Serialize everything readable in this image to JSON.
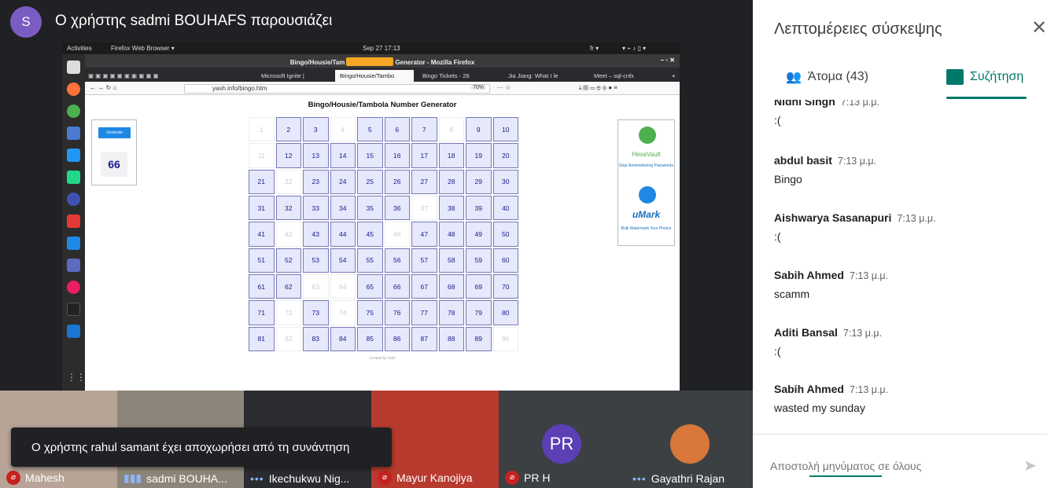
{
  "presenter": {
    "initial": "S",
    "title": "Ο χρήστης sadmi BOUHAFS παρουσιάζει"
  },
  "gnome": {
    "activities": "Activities",
    "app": "Firefox Web Browser ▾",
    "clock": "Sep 27  17:13",
    "lang": "fr ▾"
  },
  "firefox": {
    "window_title": "Bingo/Housie/Tam",
    "window_title_tail": "Generator - Mozilla Firefox",
    "tabs": [
      {
        "label": "Microsoft Ignite |"
      },
      {
        "label": "Bingo/Housie/Tambo"
      },
      {
        "label": "Bingo Tickets - 26"
      },
      {
        "label": "Jia Jiang: What I le"
      },
      {
        "label": "Meet – sql-cnfx"
      }
    ],
    "url": "yash.info/bingo.htm",
    "zoom": "70%"
  },
  "bingo": {
    "title": "Bingo/Housie/Tambola Number Generator",
    "generate_label": "Generate",
    "current": "66",
    "created_by": "Created by Yash",
    "numbers": [
      "1",
      "2",
      "3",
      "4",
      "5",
      "6",
      "7",
      "8",
      "9",
      "10",
      "11",
      "12",
      "13",
      "14",
      "15",
      "16",
      "17",
      "18",
      "19",
      "20",
      "21",
      "22",
      "23",
      "24",
      "25",
      "26",
      "27",
      "28",
      "29",
      "30",
      "31",
      "32",
      "33",
      "34",
      "35",
      "36",
      "37",
      "38",
      "39",
      "40",
      "41",
      "42",
      "43",
      "44",
      "45",
      "46",
      "47",
      "48",
      "49",
      "50",
      "51",
      "52",
      "53",
      "54",
      "55",
      "56",
      "57",
      "58",
      "59",
      "60",
      "61",
      "62",
      "63",
      "64",
      "65",
      "66",
      "67",
      "68",
      "69",
      "70",
      "71",
      "72",
      "73",
      "74",
      "75",
      "76",
      "77",
      "78",
      "79",
      "80",
      "81",
      "82",
      "83",
      "84",
      "85",
      "86",
      "87",
      "88",
      "89",
      "90"
    ],
    "called": [
      "2",
      "3",
      "5",
      "6",
      "7",
      "9",
      "10",
      "12",
      "13",
      "14",
      "15",
      "16",
      "17",
      "18",
      "19",
      "20",
      "21",
      "23",
      "24",
      "25",
      "26",
      "27",
      "28",
      "29",
      "30",
      "31",
      "32",
      "33",
      "34",
      "35",
      "36",
      "38",
      "39",
      "40",
      "41",
      "43",
      "44",
      "45",
      "47",
      "48",
      "49",
      "50",
      "51",
      "52",
      "53",
      "54",
      "55",
      "56",
      "57",
      "58",
      "59",
      "60",
      "61",
      "62",
      "65",
      "66",
      "67",
      "68",
      "69",
      "70",
      "71",
      "73",
      "75",
      "76",
      "77",
      "78",
      "79",
      "80",
      "81",
      "83",
      "84",
      "85",
      "86",
      "87",
      "88",
      "89"
    ]
  },
  "ads": {
    "hexavault_name": "HexaVault",
    "hexavault_tag": "Stop Remembering Passwords",
    "umark_name": "uMark",
    "umark_tag": "Bulk Watermark Your Photos"
  },
  "participants": [
    {
      "name": "Mahesh",
      "mic": "off"
    },
    {
      "name": "sadmi BOUHA...",
      "mic": "speaking"
    },
    {
      "name": "Ikechukwu Nig...",
      "mic": "dots"
    },
    {
      "name": "Mayur Kanojiya",
      "mic": "off"
    },
    {
      "name": "PR H",
      "mic": "off",
      "initials": "PR"
    },
    {
      "name": "Gayathri Rajan",
      "mic": "dots"
    }
  ],
  "toast": "Ο χρήστης rahul samant έχει αποχωρήσει από τη συνάντηση",
  "panel": {
    "title": "Λεπτομέρειες σύσκεψης",
    "people_tab": "Άτομα (43)",
    "chat_tab": "Συζήτηση",
    "messages": [
      {
        "sender": "Nidhi Singh",
        "time": "7:13 μ.μ.",
        "text": ":("
      },
      {
        "sender": "abdul basit",
        "time": "7:13 μ.μ.",
        "text": "Bingo"
      },
      {
        "sender": "Aishwarya Sasanapuri",
        "time": "7:13 μ.μ.",
        "text": ":("
      },
      {
        "sender": "Sabih Ahmed",
        "time": "7:13 μ.μ.",
        "text": "scamm"
      },
      {
        "sender": "Aditi Bansal",
        "time": "7:13 μ.μ.",
        "text": ":("
      },
      {
        "sender": "Sabih Ahmed",
        "time": "7:13 μ.μ.",
        "text": "wasted my sunday"
      }
    ],
    "input_placeholder": "Αποστολή μηνύματος σε όλους"
  },
  "colors": {
    "accent": "#00796b",
    "presenter_avatar": "#7b5cc2",
    "mic_off": "#c5221f",
    "bingo_called": "#e6e8fb",
    "bingo_text": "#1a1a8c"
  }
}
